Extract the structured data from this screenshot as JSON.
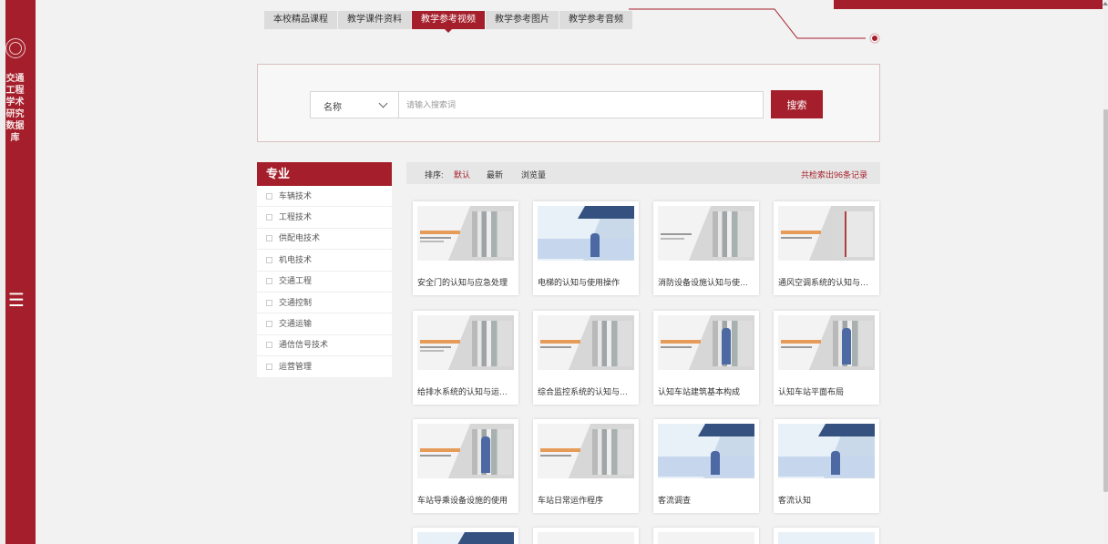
{
  "brand": {
    "vertical_title": "交通工程学术研究数据库",
    "accent_color": "#a41f2b"
  },
  "tabs": [
    {
      "label": "本校精品课程",
      "active": false
    },
    {
      "label": "教学课件资料",
      "active": false
    },
    {
      "label": "教学参考视频",
      "active": true
    },
    {
      "label": "教学参考图片",
      "active": false
    },
    {
      "label": "教学参考音频",
      "active": false
    }
  ],
  "search": {
    "field_selected": "名称",
    "placeholder": "请输入搜索词",
    "value": "",
    "button_label": "搜索"
  },
  "filter": {
    "title": "专业",
    "items": [
      "车辆技术",
      "工程技术",
      "供配电技术",
      "机电技术",
      "交通工程",
      "交通控制",
      "交通运输",
      "通信信号技术",
      "运营管理"
    ]
  },
  "sort": {
    "label": "排序:",
    "options": [
      "默认",
      "最新",
      "浏览量"
    ],
    "active": "默认",
    "result_count": "共检索出96条记录"
  },
  "videos": [
    {
      "title": "安全门的认知与应急处理",
      "icon": "video-thumbnail"
    },
    {
      "title": "电梯的认知与使用操作",
      "icon": "video-thumbnail"
    },
    {
      "title": "消防设备设施认知与使用操...",
      "icon": "video-thumbnail"
    },
    {
      "title": "通风空调系统的认知与运行...",
      "icon": "video-thumbnail"
    },
    {
      "title": "给排水系统的认知与运行管...",
      "icon": "video-thumbnail"
    },
    {
      "title": "综合监控系统的认知与使用...",
      "icon": "video-thumbnail"
    },
    {
      "title": "认知车站建筑基本构成",
      "icon": "video-thumbnail"
    },
    {
      "title": "认知车站平面布局",
      "icon": "video-thumbnail"
    },
    {
      "title": "车站导乘设备设施的使用",
      "icon": "video-thumbnail"
    },
    {
      "title": "车站日常运作程序",
      "icon": "video-thumbnail"
    },
    {
      "title": "客流调查",
      "icon": "video-thumbnail"
    },
    {
      "title": "客流认知",
      "icon": "video-thumbnail"
    }
  ]
}
